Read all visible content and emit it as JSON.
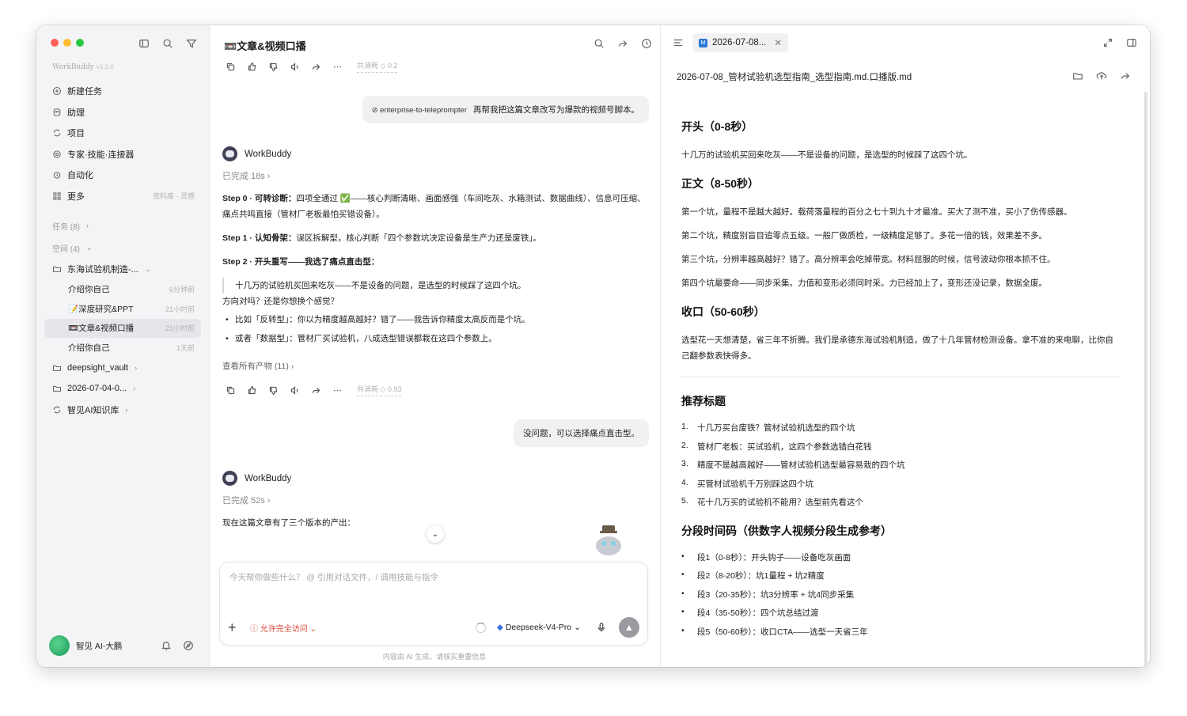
{
  "colors": {
    "close": "#ff5f57",
    "minimize": "#febc2e",
    "maximize": "#28c840",
    "accent_red": "#d84a3a",
    "md_blue": "#2b79d6"
  },
  "sidebar": {
    "brand": "WorkBuddy",
    "version": "v3.2.6",
    "menu": [
      {
        "label": "新建任务",
        "icon": "plus-circle-icon"
      },
      {
        "label": "助理",
        "icon": "assistant-icon"
      },
      {
        "label": "项目",
        "icon": "project-icon"
      },
      {
        "label": "专家·技能·连接器",
        "icon": "expert-icon"
      },
      {
        "label": "自动化",
        "icon": "automation-icon"
      },
      {
        "label": "更多",
        "icon": "grid-icon",
        "hint": "资料库 · 灵感"
      }
    ],
    "tasks_label": "任务 (8)",
    "space_label": "空间 (4)",
    "space_folder": "东海试验机制造-...",
    "sub_items": [
      {
        "label": "介绍你自己",
        "time": "6分钟前"
      },
      {
        "label": "📝深度研究&PPT",
        "time": "21小时前"
      },
      {
        "label": "📼文章&视频口播",
        "time": "21小时前",
        "active": true
      },
      {
        "label": "介绍你自己",
        "time": "1天前"
      }
    ],
    "folders": [
      "deepsight_vault",
      "2026-07-04-0..."
    ],
    "kb": "智见AI知识库",
    "user": "智见 AI-大鹏"
  },
  "chat": {
    "title": "📼文章&视频口播",
    "cost1": "共消耗 ◇ 0.2",
    "user_msg1_skill": "enterprise-to-teleprompter",
    "user_msg1": "再帮我把这篇文章改写为爆款的视频号脚本。",
    "agent_name": "WorkBuddy",
    "done1": "已完成 18s",
    "step0_label": "Step 0 · 可转诊断：",
    "step0_text": "四项全通过 ✅——核心判断清晰、画面感强（车间吃灰、水箱测试、数据曲线）、信息可压缩、痛点共鸣直接（管材厂老板最怕买错设备）。",
    "step1_label": "Step 1 · 认知骨架：",
    "step1_text": "误区拆解型，核心判断「四个参数坑决定设备是生产力还是废铁」。",
    "step2_label": "Step 2 · 开头重写——我选了痛点直击型：",
    "quote": "十几万的试验机买回来吃灰——不是设备的问题，是选型的时候踩了这四个坑。",
    "direction": "方向对吗？还是你想换个感觉？",
    "bullet1": "比如「反转型」：你以为精度越高越好？错了——我告诉你精度太高反而是个坑。",
    "bullet2": "或者「数据型」：管材厂买试验机，八成选型错误都栽在这四个参数上。",
    "view_all": "查看所有产物 (11)",
    "cost2": "共消耗 ◇ 0.93",
    "user_msg2": "没问题，可以选择痛点直击型。",
    "done2": "已完成 52s",
    "final_text": "现在这篇文章有了三个版本的产出：",
    "placeholder": "今天帮你做些什么？ @ 引用对话文件，/ 调用技能与指令",
    "access": "允许完全访问",
    "model": "Deepseek-V4-Pro",
    "disclaimer": "内容由 AI 生成，请核实重要信息"
  },
  "doc": {
    "tab": "2026-07-08...",
    "filename": "2026-07-08_管材试验机选型指南_选型指南.md.口播版.md",
    "h_open": "开头（0-8秒）",
    "p_open": "十几万的试验机买回来吃灰——不是设备的问题，是选型的时候踩了这四个坑。",
    "h_body": "正文（8-50秒）",
    "p_body": [
      "第一个坑，量程不是越大越好。载荷落量程的百分之七十到九十才最准。买大了测不准，买小了伤传感器。",
      "第二个坑，精度别盲目追零点五级。一般厂做质检，一级精度足够了。多花一倍的钱，效果差不多。",
      "第三个坑，分辨率越高越好？错了。高分辨率会吃掉带宽。材料屈服的时候，信号波动你根本抓不住。",
      "第四个坑最要命——同步采集。力值和变形必须同时采。力已经加上了，变形还没记录，数据全废。"
    ],
    "h_close": "收口（50-60秒）",
    "p_close": "选型花一天想清楚，省三年不折腾。我们是承德东海试验机制造，做了十几年管材检测设备。拿不准的来电聊，比你自己翻参数表快得多。",
    "h_titles": "推荐标题",
    "titles": [
      "十几万买台废铁？管材试验机选型的四个坑",
      "管材厂老板：买试验机，这四个参数选错白花钱",
      "精度不是越高越好——管材试验机选型最容易栽的四个坑",
      "买管材试验机千万别踩这四个坑",
      "花十几万买的试验机不能用？选型前先看这个"
    ],
    "h_segments": "分段时间码（供数字人视频分段生成参考）",
    "segments": [
      "段1（0-8秒）：开头钩子——设备吃灰画面",
      "段2（8-20秒）：坑1量程 + 坑2精度",
      "段3（20-35秒）：坑3分辨率 + 坑4同步采集",
      "段4（35-50秒）：四个坑总结过渡",
      "段5（50-60秒）：收口CTA——选型一天省三年"
    ]
  }
}
